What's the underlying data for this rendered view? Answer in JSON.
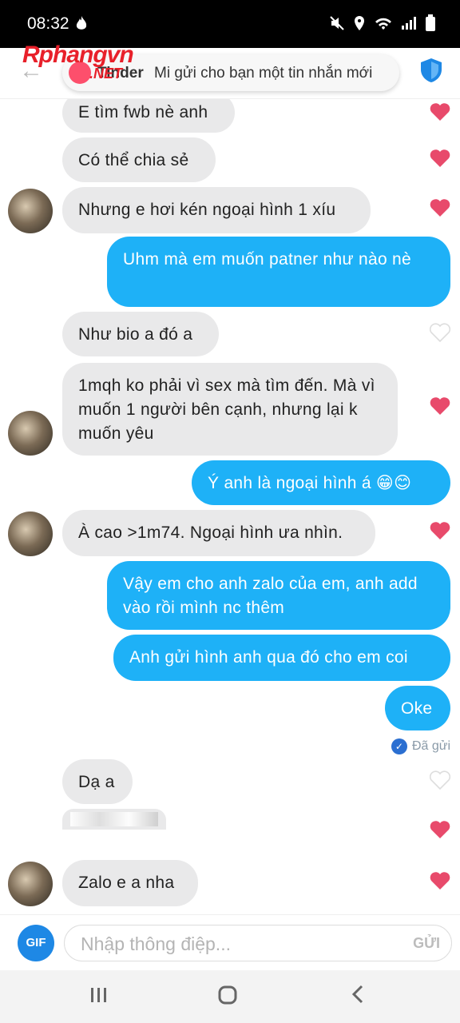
{
  "status_bar": {
    "time": "08:32"
  },
  "header": {
    "watermark": "Rphangvn",
    "watermark_suffix": ".NET",
    "toast_app": "Tinder",
    "toast_message": "Mi gửi cho bạn một tin nhắn mới"
  },
  "messages": [
    {
      "text": "E tìm fwb nè anh"
    },
    {
      "text": "Có thể chia sẻ"
    },
    {
      "text": "Nhưng e hơi kén ngoại hình 1 xíu"
    },
    {
      "text": "Uhm mà em muốn patner như nào nè"
    },
    {
      "text": "Như bio a đó a"
    },
    {
      "text": "1mqh ko phải vì sex mà tìm đến. Mà vì muốn 1 người bên cạnh, nhưng lại k muốn yêu"
    },
    {
      "text": "Ý anh là ngoại hình á 😁😊"
    },
    {
      "text": "À cao >1m74. Ngoại hình ưa nhìn."
    },
    {
      "text": "Vậy em cho anh zalo của em, anh add vào rồi mình nc thêm"
    },
    {
      "text": "Anh gửi hình anh qua đó cho em coi"
    },
    {
      "text": "Oke"
    },
    {
      "text": "Dạ a"
    },
    {
      "text": "Zalo e a nha"
    }
  ],
  "seen_label": "Đã gửi",
  "composer": {
    "gif_label": "GIF",
    "placeholder": "Nhập thông điệp...",
    "send_label": "GỬI"
  },
  "colors": {
    "accent": "#1eb1f7",
    "heart": "#e84a6b",
    "brand": "#fd4f6c"
  }
}
